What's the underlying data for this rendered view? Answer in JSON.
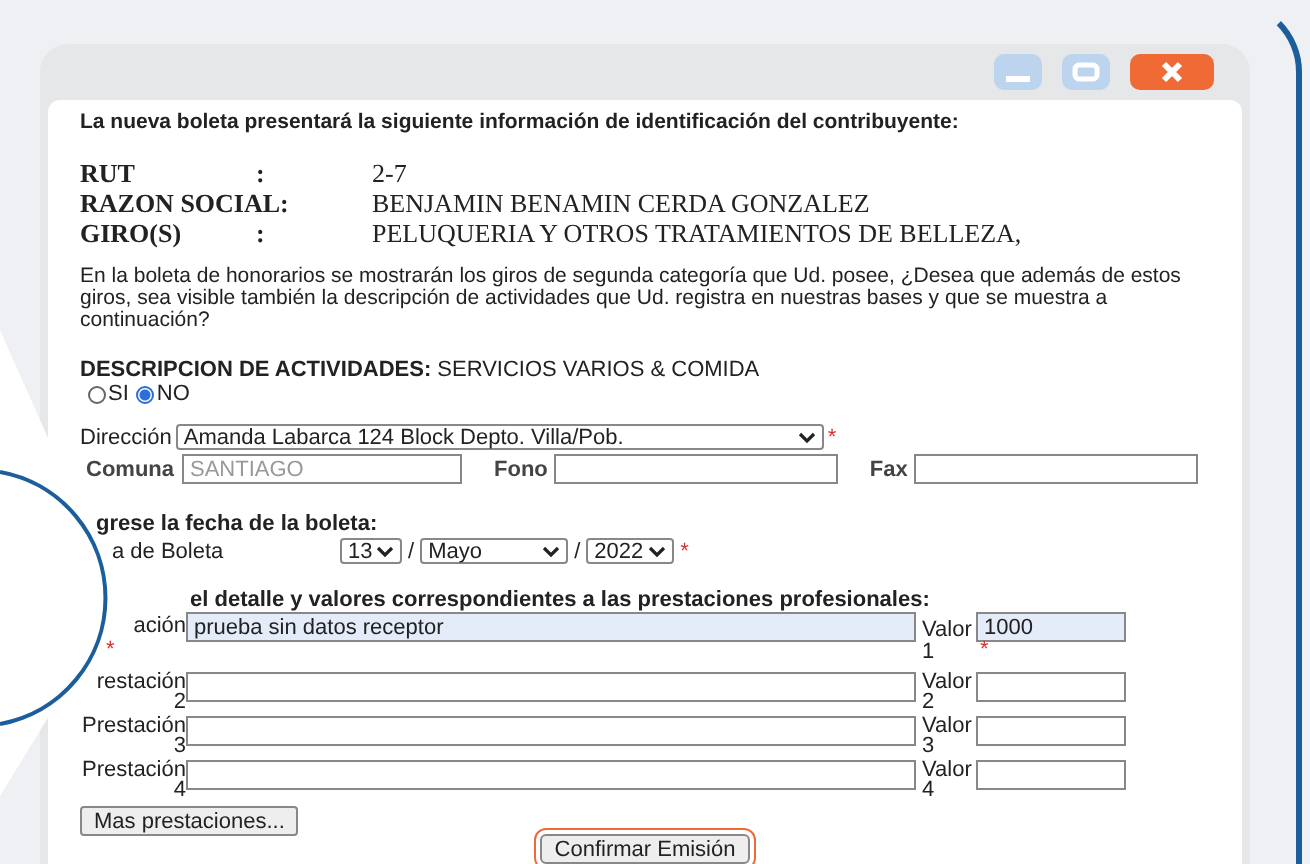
{
  "window": {
    "controls": [
      {
        "kind": "minimize"
      },
      {
        "kind": "maximize"
      },
      {
        "kind": "close"
      }
    ]
  },
  "intro": "La nueva boleta presentará la siguiente información de identificación del contribuyente:",
  "taxpayer": [
    {
      "label": "RUT",
      "sep": ":",
      "value": "2-7"
    },
    {
      "label": "RAZON SOCIAL:",
      "value": "BENJAMIN BENAMIN CERDA GONZALEZ"
    },
    {
      "label": "GIRO(S)",
      "sep": ":",
      "value": "PELUQUERIA Y OTROS TRATAMIENTOS DE BELLEZA,"
    }
  ],
  "question": "En la boleta de honorarios se mostrarán los giros de segunda categoría que Ud. posee, ¿Desea que además de estos giros, sea visible también la descripción de actividades que Ud. registra en nuestras bases y que se muestra a continuación?",
  "activities": {
    "label": "DESCRIPCION DE ACTIVIDADES:",
    "value": "SERVICIOS VARIOS & COMIDA"
  },
  "visible_options": [
    {
      "label": "SI",
      "selected": false
    },
    {
      "label": "NO",
      "selected": true
    }
  ],
  "address": {
    "label": "Dirección",
    "value": "Amanda Labarca 124 Block Depto. Villa/Pob.",
    "required": "*"
  },
  "comuna": {
    "label": "Comuna",
    "value": "SANTIAGO",
    "disabled": true
  },
  "fono": {
    "label": "Fono"
  },
  "fax": {
    "label": "Fax"
  },
  "date_heading": "grese la fecha de la boleta:",
  "date": {
    "label": "a de Boleta",
    "day": "13",
    "separator_1": "/",
    "month": "Mayo",
    "separator_2": "/",
    "year": "2022",
    "required": "*"
  },
  "detail_heading": "el detalle y valores correspondientes a las prestaciones profesionales:",
  "services": [
    {
      "label": "ación",
      "value": "prueba sin datos receptor",
      "value_label": "Valor\n1",
      "amount": "1000",
      "required": "*",
      "amount_required": "*"
    },
    {
      "label": "restación\n2",
      "value_label": "Valor\n2"
    },
    {
      "label": "Prestación\n3",
      "value_label": "Valor\n3"
    },
    {
      "label": "Prestación\n4",
      "value_label": "Valor\n4"
    }
  ],
  "more_button": "Mas prestaciones...",
  "confirm_button": "Confirmar Emisión"
}
